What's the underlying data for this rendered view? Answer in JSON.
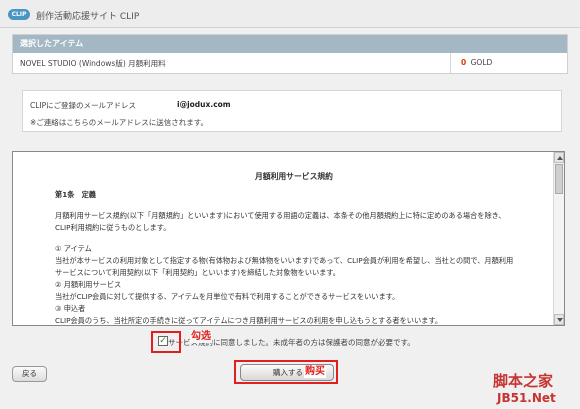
{
  "header": {
    "logo_text": "CLIP",
    "site_title": "創作活動応援サイト CLIP"
  },
  "item_panel": {
    "heading": "選択したアイテム",
    "item_name": "NOVEL STUDIO (Windows版) 月額利用料",
    "price_value": "0",
    "price_unit": "GOLD"
  },
  "mail": {
    "label": "CLIPにご登録のメールアドレス",
    "address": "i@jodux.com",
    "note": "※ご連絡はこちらのメールアドレスに送信されます。"
  },
  "terms": {
    "title": "月額利用サービス規約",
    "lines": [
      "第1条　定義",
      "月額利用サービス規約(以下「月額規約」といいます)において使用する用語の定義は、本条その他月額規約上に特に定めのある場合を除き、",
      "CLIP利用規約に従うものとします。",
      "① アイテム",
      "当社が本サービスの利用対象として指定する物(有体物および無体物をいいます)であって、CLIP会員が利用を希望し、当社との間で、月額利用",
      "サービスについて利用契約(以下「利用契約」といいます)を締結した対象物をいいます。",
      "② 月額利用サービス",
      "当社がCLIP会員に対して提供する、アイテムを月単位で有料で利用することができるサービスをいいます。",
      "③ 申込者",
      "CLIP会員のうち、当社所定の手続きに従ってアイテムにつき月額利用サービスの利用を申し込もうとする者をいいます。"
    ]
  },
  "agree": {
    "label": "サービス規約に同意しました。未成年者の方は保護者の同意が必要です。",
    "checked": true,
    "check_glyph": "✓"
  },
  "annotations": {
    "check_note": "勾选",
    "buy_note": "购买"
  },
  "buttons": {
    "back": "戻る",
    "buy": "購入する"
  },
  "watermark": {
    "line1": "脚本之家",
    "line2": "JB51.Net"
  },
  "colors": {
    "accent_blue": "#4a95c4",
    "heading_bar": "#a4b7c4",
    "annotation_red": "#e02020",
    "price_orange": "#d04000"
  },
  "icons": {
    "scroll_up": "triangle-up",
    "scroll_down": "triangle-down",
    "checkbox": "check-mark"
  }
}
